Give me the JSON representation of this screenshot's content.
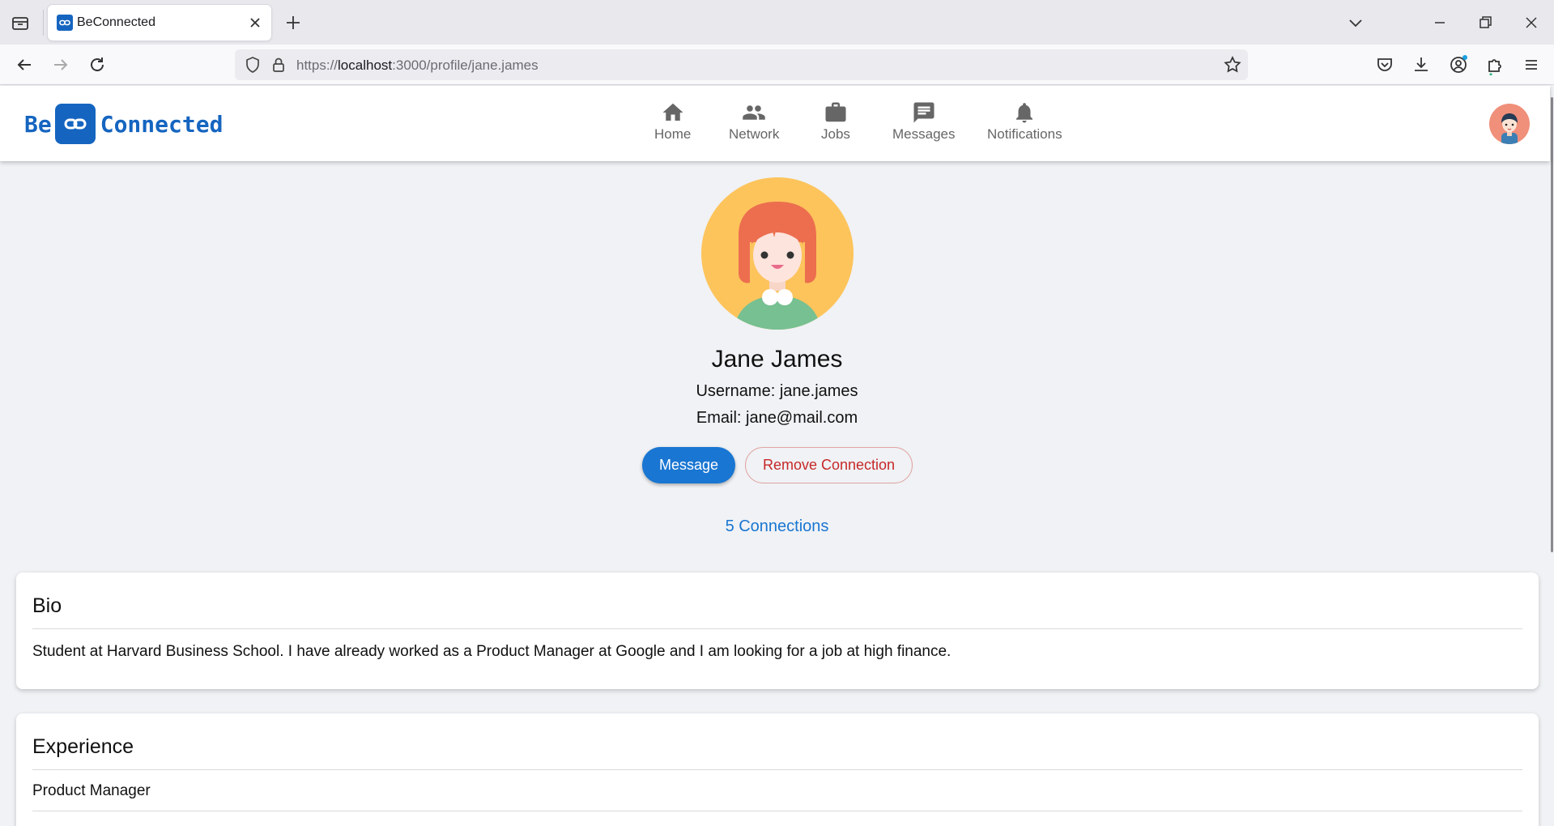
{
  "browser": {
    "tab_title": "BeConnected",
    "url_scheme": "https://",
    "url_host": "localhost",
    "url_rest": ":3000/profile/jane.james"
  },
  "app": {
    "logo_left": "Be",
    "logo_right": "Connected",
    "nav": [
      {
        "label": "Home",
        "icon": "home-icon"
      },
      {
        "label": "Network",
        "icon": "people-icon"
      },
      {
        "label": "Jobs",
        "icon": "briefcase-icon"
      },
      {
        "label": "Messages",
        "icon": "message-icon"
      },
      {
        "label": "Notifications",
        "icon": "bell-icon"
      }
    ],
    "brand_color": "#1565c0"
  },
  "profile": {
    "name": "Jane James",
    "username_line": "Username: jane.james",
    "email_line": "Email: jane@mail.com",
    "message_button": "Message",
    "remove_button": "Remove Connection",
    "connections": "5 Connections"
  },
  "bio": {
    "title": "Bio",
    "text": "Student at Harvard Business School. I have already worked as a Product Manager at Google and I am looking for a job at high finance."
  },
  "experience": {
    "title": "Experience",
    "items": [
      "Product Manager"
    ]
  }
}
